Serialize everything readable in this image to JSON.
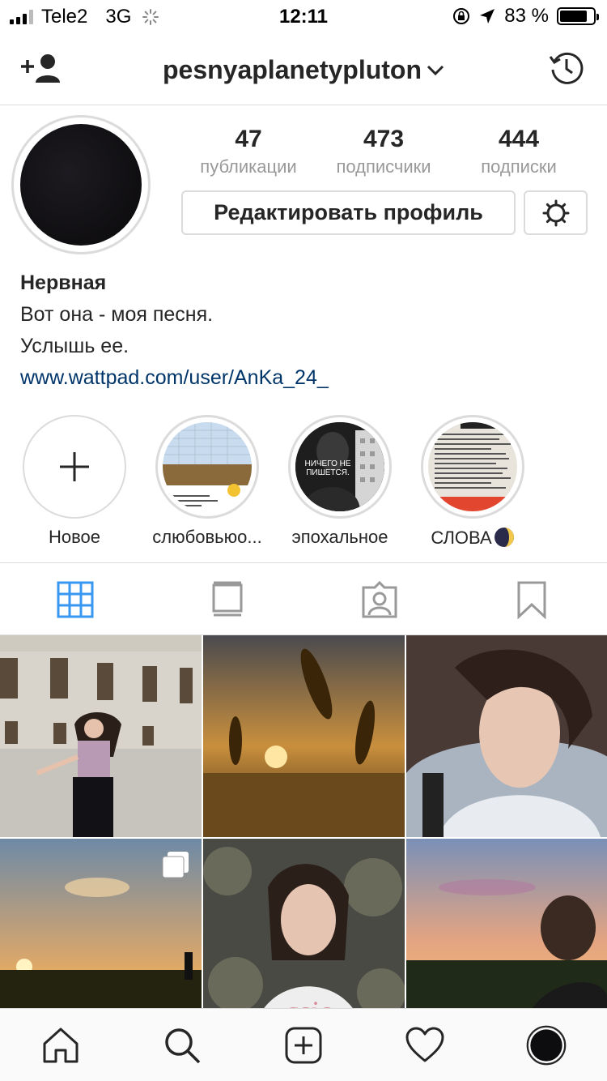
{
  "status_bar": {
    "carrier": "Tele2",
    "network": "3G",
    "time": "12:11",
    "battery": "83 %",
    "battery_level": 0.83
  },
  "header": {
    "username": "pesnyaplanetypluton"
  },
  "profile": {
    "stats": [
      {
        "value": "47",
        "label": "публикации"
      },
      {
        "value": "473",
        "label": "подписчики"
      },
      {
        "value": "444",
        "label": "подписки"
      }
    ],
    "edit_button": "Редактировать профиль",
    "name": "Нервная",
    "bio_line1": "Вот она - моя песня.",
    "bio_line2": "Услышь ее.",
    "link": "www.wattpad.com/user/AnKa_24_"
  },
  "highlights": [
    {
      "label": "Новое"
    },
    {
      "label": "слюбовьюо..."
    },
    {
      "label": "эпохальное",
      "overlay_text": "НИЧЕГО НЕ ПИШЕТСЯ."
    },
    {
      "label": "СЛОВА"
    }
  ],
  "tabs": [
    "grid-icon",
    "feed-icon",
    "tagged-icon",
    "saved-icon"
  ],
  "colors": {
    "accent": "#3897f0",
    "link": "#003569",
    "border": "#dbdbdb",
    "muted": "#999999"
  }
}
